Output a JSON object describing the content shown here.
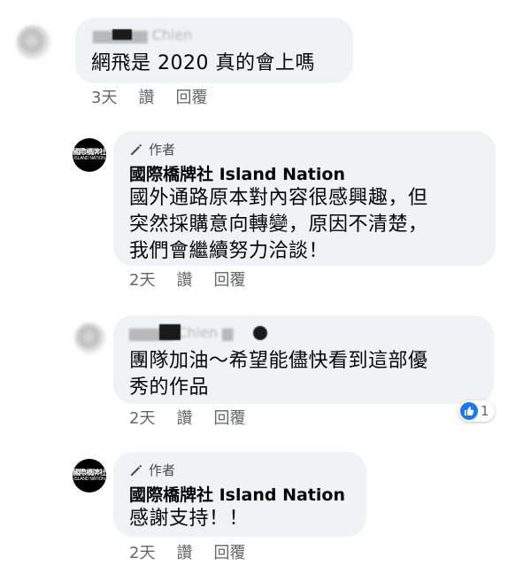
{
  "comments": [
    {
      "text_lines": [
        "網飛是 2020 真的會上嗎"
      ],
      "actions": {
        "time": "3天",
        "like": "讚",
        "reply": "回覆"
      }
    },
    {
      "author_badge": "作者",
      "page_name": "國際橋牌社 Island Nation",
      "text_lines": [
        "國外通路原本對內容很感興趣，但",
        "突然採購意向轉變，原因不清楚，",
        "我們會繼續努力洽談！"
      ],
      "actions": {
        "time": "2天",
        "like": "讚",
        "reply": "回覆"
      }
    },
    {
      "text_lines": [
        "團隊加油～希望能儘快看到這部優",
        "秀的作品"
      ],
      "reaction": {
        "count": "1",
        "icon": "like-icon",
        "color": "#1877f2"
      },
      "actions": {
        "time": "2天",
        "like": "讚",
        "reply": "回覆"
      }
    },
    {
      "author_badge": "作者",
      "page_name": "國際橋牌社 Island Nation",
      "text_lines": [
        "感謝支持！！"
      ],
      "actions": {
        "time": "2天",
        "like": "讚",
        "reply": "回覆"
      }
    }
  ],
  "colors": {
    "bubble": "#f0f2f5",
    "meta_text": "#65676b",
    "like_blue": "#1877f2"
  }
}
